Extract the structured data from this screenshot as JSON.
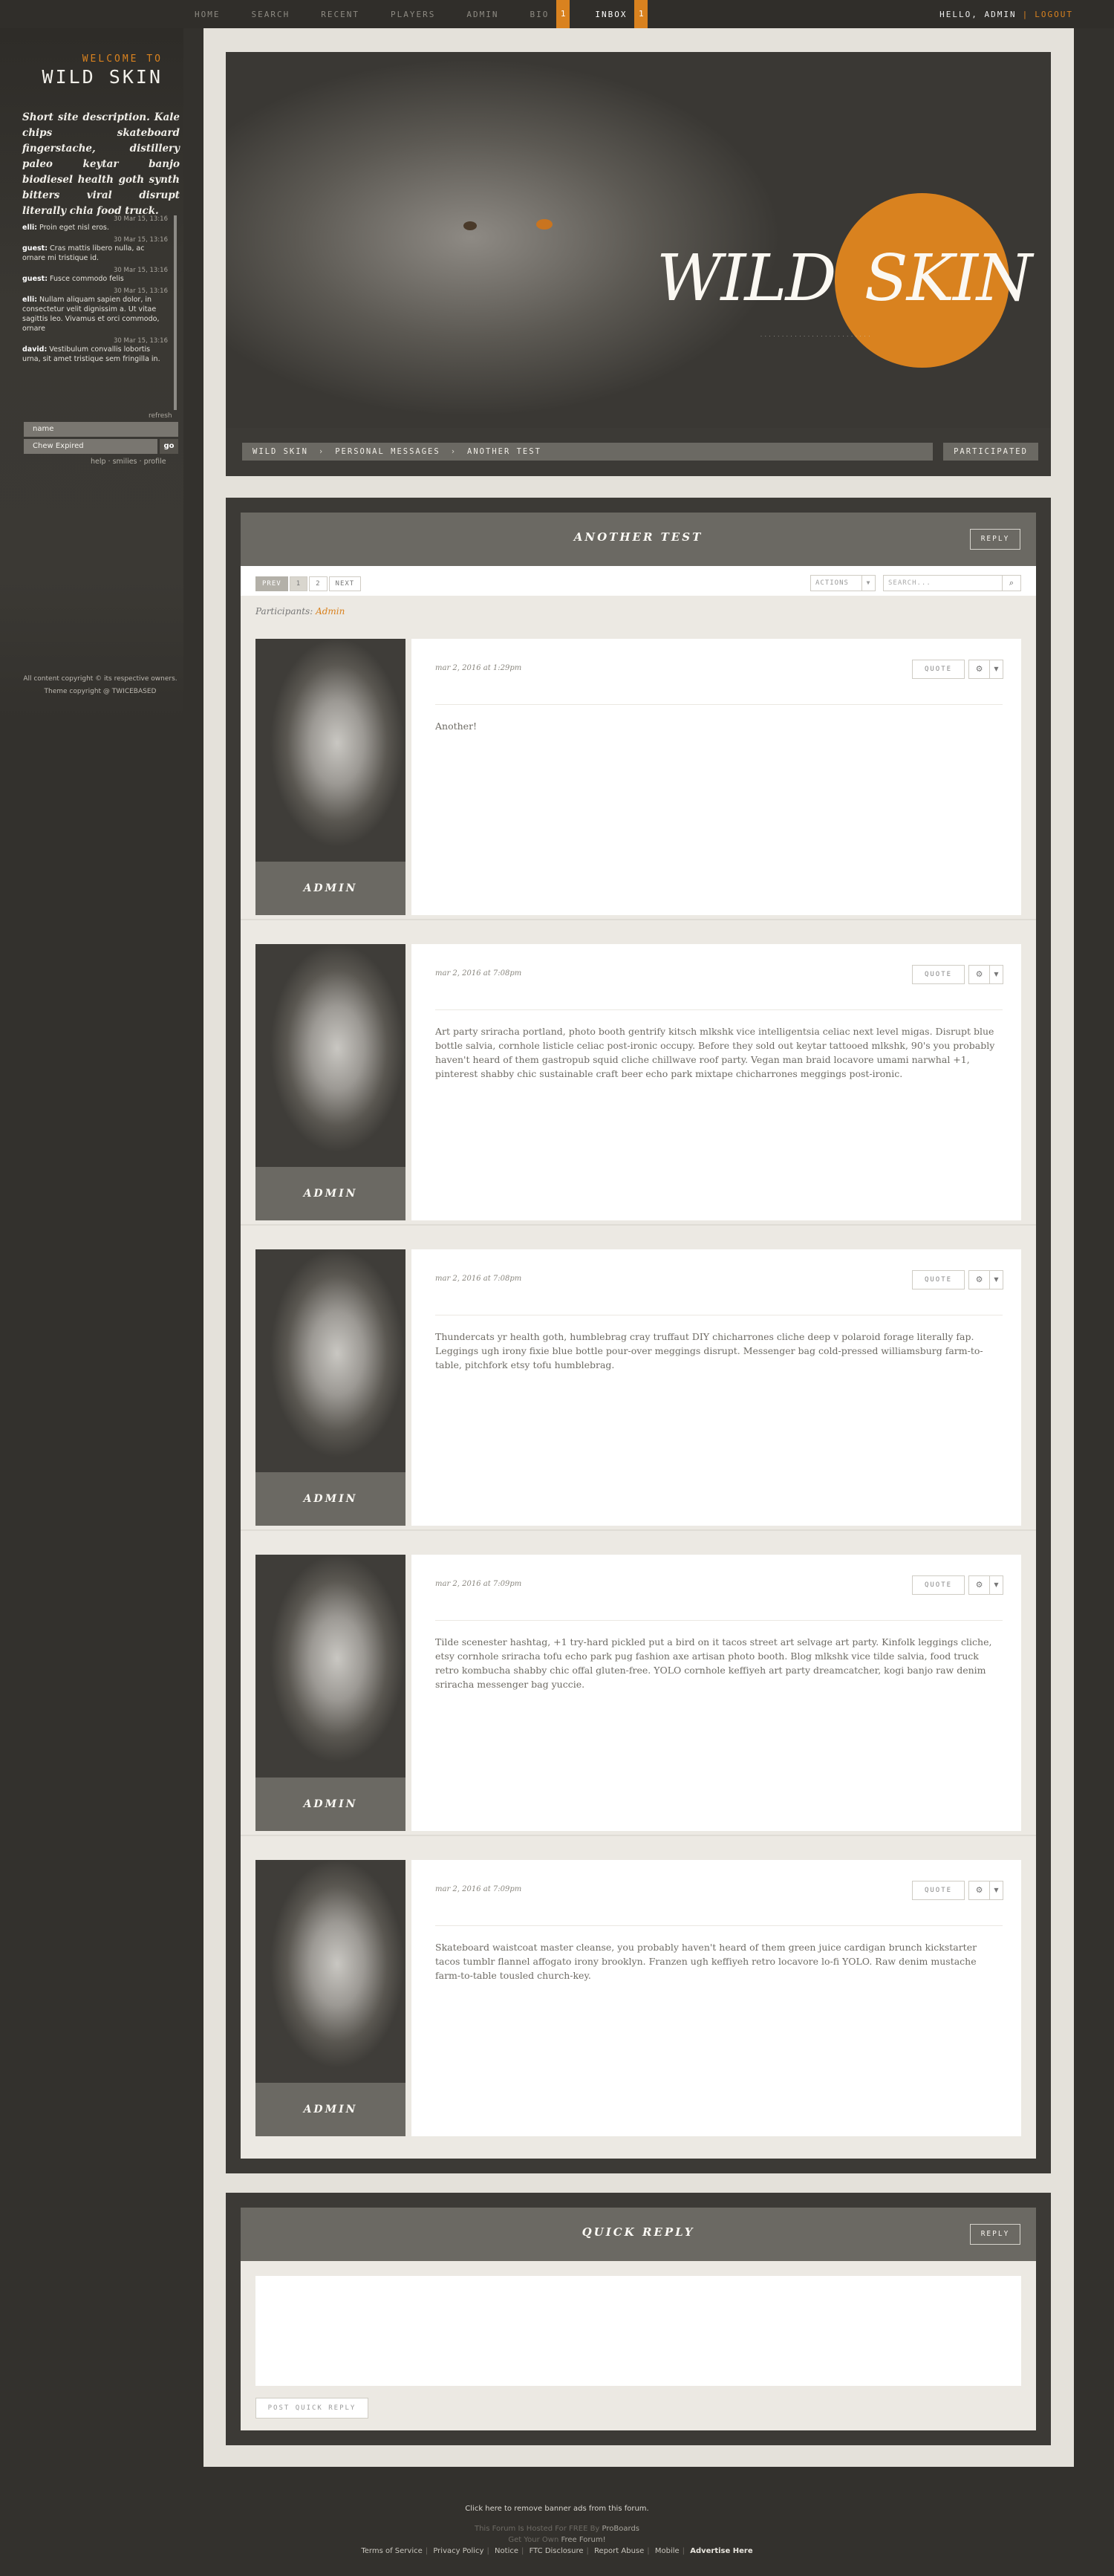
{
  "topnav": {
    "items": [
      "HOME",
      "SEARCH",
      "RECENT",
      "PLAYERS",
      "ADMIN",
      "BIO",
      "INBOX"
    ],
    "bio_badge": "1",
    "inbox_badge": "1",
    "greeting": "HELLO, ADMIN",
    "separator": "|",
    "logout": "LOGOUT"
  },
  "sidebar": {
    "welcome_to": "WELCOME TO",
    "site_name": "WILD SKIN",
    "description": "Short site description. Kale chips skateboard fingerstache, distillery paleo keytar banjo biodiesel health goth synth bitters viral disrupt literally chia food truck.",
    "shouts": [
      {
        "time": "30 Mar 15, 13:16",
        "user": "elli:",
        "text": "Proin eget nisl eros."
      },
      {
        "time": "30 Mar 15, 13:16",
        "user": "guest:",
        "text": "Cras mattis libero nulla, ac ornare mi tristique id."
      },
      {
        "time": "30 Mar 15, 13:16",
        "user": "guest:",
        "text": "Fusce commodo felis"
      },
      {
        "time": "30 Mar 15, 13:16",
        "user": "elli:",
        "text": "Nullam aliquam sapien dolor, in consectetur velit dignissim a. Ut vitae sagittis leo. Vivamus et orci commodo, ornare"
      },
      {
        "time": "30 Mar 15, 13:16",
        "user": "david:",
        "text": "Vestibulum convallis lobortis urna, sit amet tristique sem fringilla in."
      }
    ],
    "refresh": "refresh",
    "name_field": "name",
    "message_field": "Chew Expired",
    "go": "go",
    "links": "help · smilies · profile",
    "copyright_1": "All content copyright © its respective owners.",
    "copyright_2": "Theme copyright @ TWICEBASED"
  },
  "banner": {
    "title_1": "WILD",
    "title_2": "SKIN",
    "tagline": "· · · · · · · · · · · · · · · · · · · · · · · · · ·"
  },
  "breadcrumb": {
    "items": [
      "WILD SKIN",
      "PERSONAL MESSAGES",
      "ANOTHER TEST"
    ],
    "arrow": "›",
    "participated": "PARTICIPATED"
  },
  "thread": {
    "title": "ANOTHER TEST",
    "reply": "REPLY",
    "pager": {
      "prev": "PREV",
      "p1": "1",
      "p2": "2",
      "next": "NEXT"
    },
    "actions": "ACTIONS",
    "search_placeholder": "SEARCH...",
    "participants_label": "Participants:",
    "participants_name": "Admin",
    "quote_label": "QUOTE",
    "posts": [
      {
        "user": "ADMIN",
        "date": "mar 2, 2016 at 1:29pm",
        "content": "Another!"
      },
      {
        "user": "ADMIN",
        "date": "mar 2, 2016 at 7:08pm",
        "content": "Art party sriracha portland, photo booth gentrify kitsch mlkshk vice intelligentsia celiac next level migas. Disrupt blue bottle salvia, cornhole listicle celiac post-ironic occupy. Before they sold out keytar tattooed mlkshk, 90's you probably haven't heard of them gastropub squid cliche chillwave roof party. Vegan man braid locavore umami narwhal +1, pinterest shabby chic sustainable craft beer echo park mixtape chicharrones meggings post-ironic."
      },
      {
        "user": "ADMIN",
        "date": "mar 2, 2016 at 7:08pm",
        "content": "Thundercats yr health goth, humblebrag cray truffaut DIY chicharrones cliche deep v polaroid forage literally fap. Leggings ugh irony fixie blue bottle pour-over meggings disrupt. Messenger bag cold-pressed williamsburg farm-to-table, pitchfork etsy tofu humblebrag."
      },
      {
        "user": "ADMIN",
        "date": "mar 2, 2016 at 7:09pm",
        "content": "Tilde scenester hashtag, +1 try-hard pickled put a bird on it tacos street art selvage art party. Kinfolk leggings cliche, etsy cornhole sriracha tofu echo park pug fashion axe artisan photo booth. Blog mlkshk vice tilde salvia, food truck retro kombucha shabby chic offal gluten-free. YOLO cornhole keffiyeh art party dreamcatcher, kogi banjo raw denim sriracha messenger bag yuccie."
      },
      {
        "user": "ADMIN",
        "date": "mar 2, 2016 at 7:09pm",
        "content": "Skateboard waistcoat master cleanse, you probably haven't heard of them green juice cardigan brunch kickstarter tacos tumblr flannel affogato irony brooklyn. Franzen ugh keffiyeh retro locavore lo-fi YOLO. Raw denim mustache farm-to-table tousled church-key."
      }
    ]
  },
  "quick_reply": {
    "title": "QUICK REPLY",
    "reply": "REPLY",
    "post_button": "POST QUICK REPLY"
  },
  "footer": {
    "remove_ads": "Click here to remove banner ads from this forum.",
    "hosted_1": "This Forum Is Hosted For FREE By",
    "hosted_brand": "ProBoards",
    "own_1": "Get Your Own",
    "own_brand": "Free Forum!",
    "links": [
      "Terms of Service",
      "Privacy Policy",
      "Notice",
      "FTC Disclosure",
      "Report Abuse",
      "Mobile"
    ],
    "advertise": "Advertise Here"
  },
  "colors": {
    "accent": "#d9821f",
    "header_gray": "#6b6963",
    "frame": "#3c3a36",
    "background": "#33312d"
  }
}
